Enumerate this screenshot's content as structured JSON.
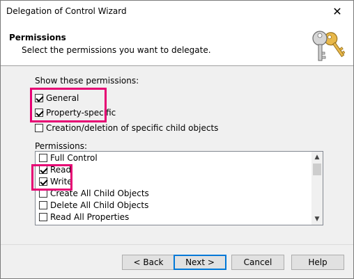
{
  "window": {
    "title": "Delegation of Control Wizard",
    "close_glyph": "✕"
  },
  "header": {
    "title": "Permissions",
    "subtitle": "Select the permissions you want to delegate.",
    "icon": "keys-icon"
  },
  "show": {
    "label": "Show these permissions:",
    "options": [
      {
        "label": "General",
        "checked": true
      },
      {
        "label": "Property-specific",
        "checked": true
      },
      {
        "label": "Creation/deletion of specific child objects",
        "checked": false
      }
    ]
  },
  "permissions": {
    "label": "Permissions:",
    "items": [
      {
        "label": "Full Control",
        "checked": false
      },
      {
        "label": "Read",
        "checked": true
      },
      {
        "label": "Write",
        "checked": true
      },
      {
        "label": "Create All Child Objects",
        "checked": false
      },
      {
        "label": "Delete All Child Objects",
        "checked": false
      },
      {
        "label": "Read All Properties",
        "checked": false
      }
    ]
  },
  "buttons": {
    "back": "< Back",
    "next": "Next >",
    "cancel": "Cancel",
    "help": "Help"
  },
  "colors": {
    "highlight": "#e60073",
    "default_button_border": "#0078d7"
  }
}
